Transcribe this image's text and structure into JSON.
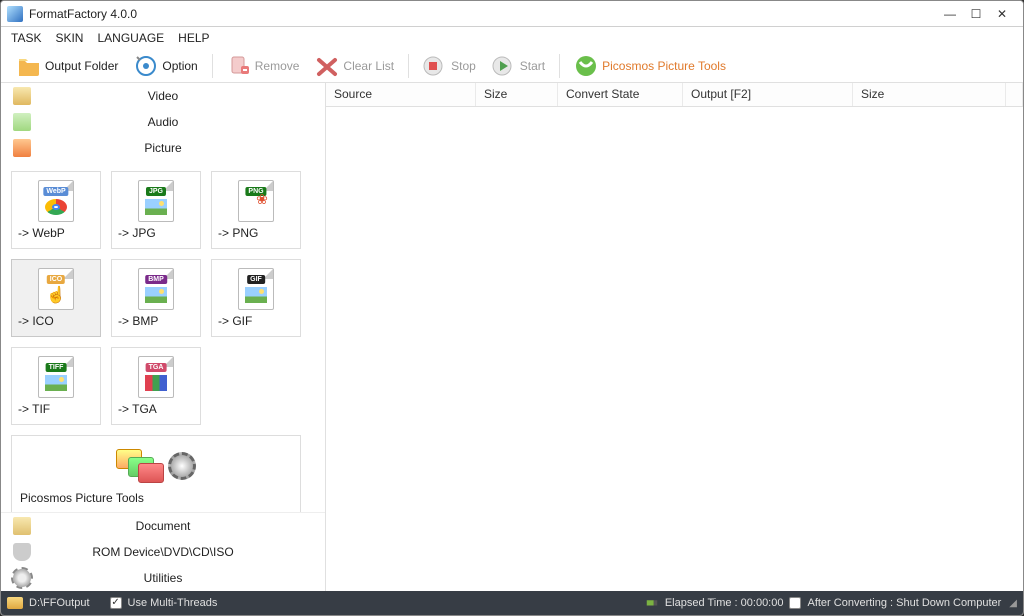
{
  "title": "FormatFactory 4.0.0",
  "menus": {
    "task": "TASK",
    "skin": "SKIN",
    "language": "LANGUAGE",
    "help": "HELP"
  },
  "toolbar": {
    "output_folder": "Output Folder",
    "option": "Option",
    "remove": "Remove",
    "clear_list": "Clear List",
    "stop": "Stop",
    "start": "Start",
    "picosmos": "Picosmos Picture Tools"
  },
  "sidebar": {
    "video": "Video",
    "audio": "Audio",
    "picture": "Picture",
    "document": "Document",
    "rom": "ROM Device\\DVD\\CD\\ISO",
    "utilities": "Utilities"
  },
  "tiles": {
    "webp": "-> WebP",
    "jpg": "-> JPG",
    "png": "-> PNG",
    "ico": "-> ICO",
    "bmp": "-> BMP",
    "gif": "-> GIF",
    "tif": "-> TIF",
    "tga": "-> TGA",
    "picosmos": "Picosmos Picture Tools",
    "tags": {
      "webp": "WebP",
      "jpg": "JPG",
      "png": "PNG",
      "ico": "ICO",
      "bmp": "BMP",
      "gif": "GIF",
      "tiff": "TIFF",
      "tga": "TGA"
    }
  },
  "table": {
    "columns": {
      "source": "Source",
      "size": "Size",
      "convert_state": "Convert State",
      "output": "Output [F2]",
      "size2": "Size"
    }
  },
  "statusbar": {
    "path": "D:\\FFOutput",
    "multithreads_label": "Use Multi-Threads",
    "multithreads_checked": true,
    "elapsed": "Elapsed Time :  00:00:00",
    "after_label": "After Converting : Shut Down Computer",
    "after_checked": false
  }
}
